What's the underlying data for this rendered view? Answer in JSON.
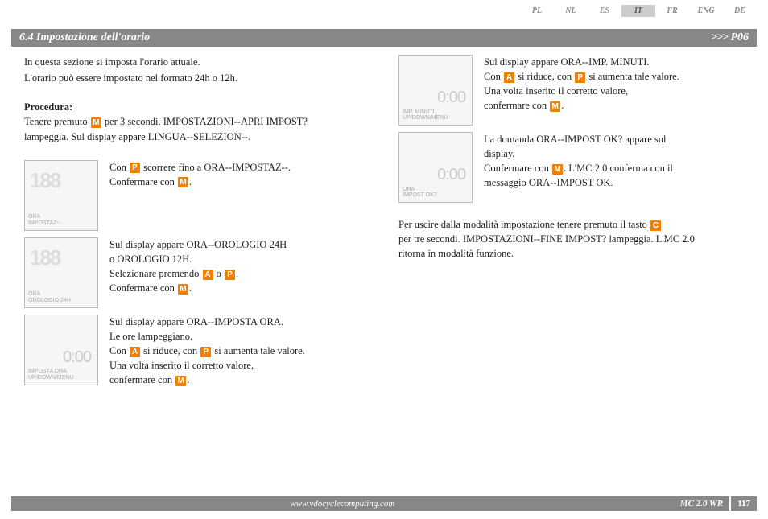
{
  "langs": {
    "items": [
      "PL",
      "NL",
      "ES",
      "IT",
      "FR",
      "ENG",
      "DE"
    ],
    "active": "IT"
  },
  "titlebar": {
    "title": "6.4 Impostazione dell'orario",
    "arrows": ">>>",
    "code": "P06"
  },
  "intro": {
    "l1": "In questa sezione si imposta l'orario attuale.",
    "l2": "L'orario può essere impostato nel formato 24h o 12h."
  },
  "procedura": {
    "label": "Procedura:",
    "l1a": "Tenere premuto ",
    "l1b": " per 3 secondi. IMPOSTAZIONI--APRI IMPOST?",
    "l2": "lampeggia. Sul display appare LINGUA--SELEZION--."
  },
  "left": {
    "s1": {
      "thumb1": "ORA",
      "thumb2": "IMPOSTAZ--",
      "a": "Con ",
      "b": " scorrere fino a ORA--IMPOSTAZ--.",
      "c": "Confermare con ",
      "d": "."
    },
    "s2": {
      "thumb1": "ORA",
      "thumb2": "OROLOGIO 24H",
      "a": "Sul display appare ORA--OROLOGIO 24H",
      "b": "o OROLOGIO 12H.",
      "c": "Selezionare premendo ",
      "d": " o ",
      "e": ".",
      "f": "Confermare con ",
      "g": "."
    },
    "s3": {
      "big": "0:00",
      "thumb1": "IMPOSTA ORA",
      "thumb2": "UP/DOWN/MENU",
      "a": "Sul display appare ORA--IMPOSTA ORA.",
      "b": "Le ore lampeggiano.",
      "c": "Con ",
      "d": " si riduce, con ",
      "e": " si aumenta tale valore.",
      "f": "Una volta inserito il corretto valore,",
      "g": "confermare con ",
      "h": "."
    }
  },
  "right": {
    "s4": {
      "big": "0:00",
      "thumb1": "IMP. MINUTI",
      "thumb2": "UP/DOWN/MENU",
      "a": "Sul display appare ORA--IMP. MINUTI.",
      "b": "Con ",
      "c": " si riduce, con ",
      "d": " si aumenta tale valore.",
      "e": "Una volta inserito il corretto valore,",
      "f": "confermare con ",
      "g": "."
    },
    "s5": {
      "big": "0:00",
      "thumb1": "ORA",
      "thumb2": "IMPOST OK?",
      "a": "La domanda ORA--IMPOST OK? appare sul",
      "b": "display.",
      "c": "Confermare con ",
      "d": ". L'MC 2.0 conferma con il",
      "e": "messaggio ORA--IMPOST OK."
    },
    "exit": {
      "a": "Per uscire dalla modalità impostazione tenere premuto il tasto ",
      "b": "per tre secondi. IMPOSTAZIONI--FINE IMPOST? lampeggia. L'MC 2.0",
      "c": "ritorna in modalità funzione."
    }
  },
  "keys": {
    "M": "M",
    "P": "P",
    "A": "A",
    "C": "C"
  },
  "footer": {
    "url": "www.vdocyclecomputing.com",
    "model": "MC 2.0 WR",
    "page": "117"
  }
}
